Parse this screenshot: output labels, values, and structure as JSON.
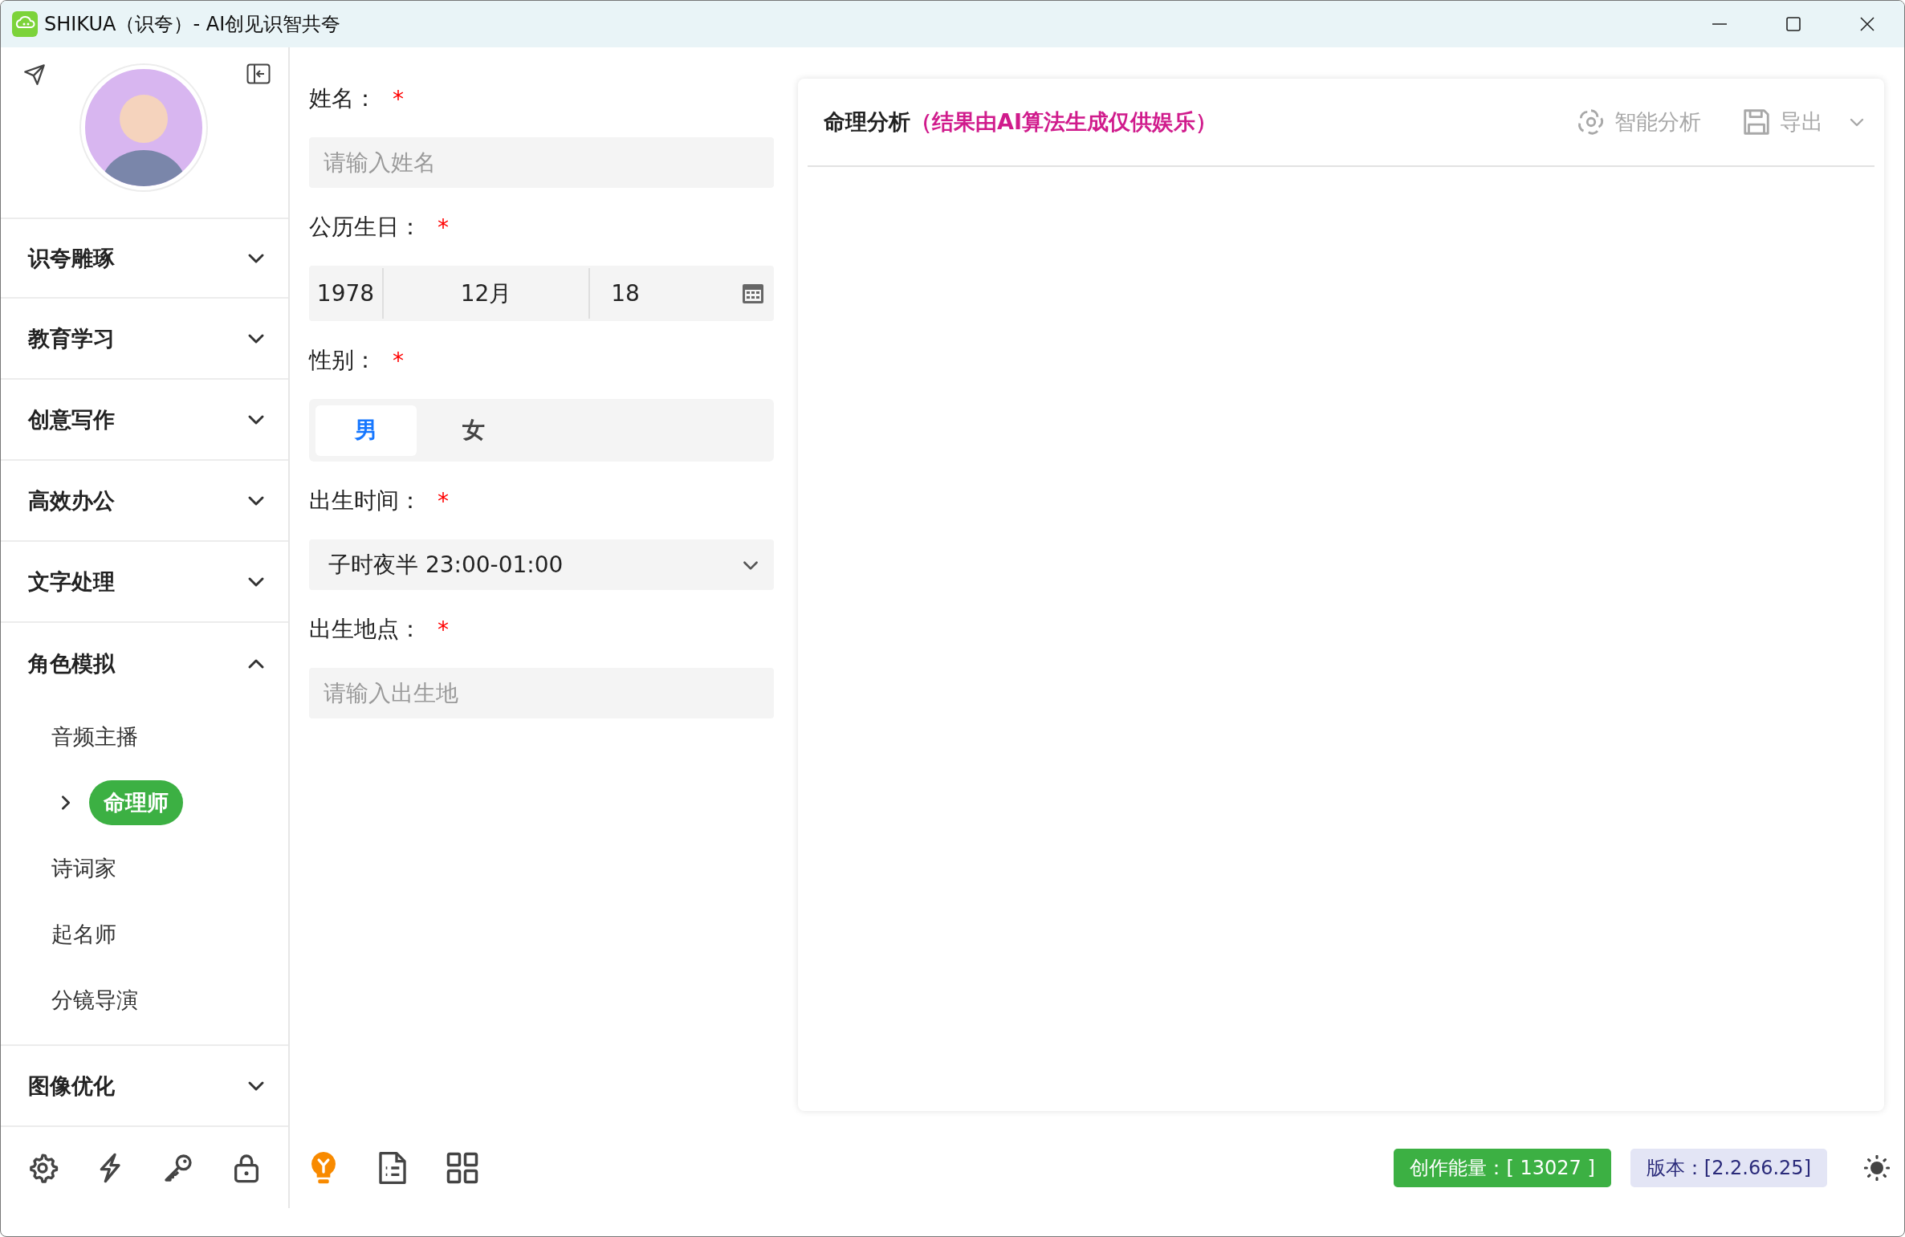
{
  "window": {
    "title": "SHIKUA（识夸）- AI创见识智共夸"
  },
  "sidebar": {
    "categories": [
      {
        "label": "识夸雕琢",
        "expanded": false
      },
      {
        "label": "教育学习",
        "expanded": false
      },
      {
        "label": "创意写作",
        "expanded": false
      },
      {
        "label": "高效办公",
        "expanded": false
      },
      {
        "label": "文字处理",
        "expanded": false
      },
      {
        "label": "角色模拟",
        "expanded": true,
        "children": [
          {
            "label": "音频主播",
            "selected": false
          },
          {
            "label": "命理师",
            "selected": true
          },
          {
            "label": "诗词家",
            "selected": false
          },
          {
            "label": "起名师",
            "selected": false
          },
          {
            "label": "分镜导演",
            "selected": false
          }
        ]
      },
      {
        "label": "图像优化",
        "expanded": false
      }
    ]
  },
  "form": {
    "fields": [
      {
        "kind": "text",
        "label": "姓名：",
        "mark": "*",
        "placeholder": "请输入姓名"
      },
      {
        "kind": "date",
        "label": "公历生日：",
        "mark": "*",
        "year": "1978",
        "month": "12月",
        "day": "18"
      },
      {
        "kind": "segmented",
        "label": "性别：",
        "mark": "*",
        "options": [
          {
            "label": "男",
            "selected": true
          },
          {
            "label": "女",
            "selected": false
          }
        ]
      },
      {
        "kind": "select",
        "label": "出生时间：",
        "mark": "*",
        "value": "子时夜半 23:00-01:00"
      },
      {
        "kind": "text",
        "label": "出生地点：",
        "mark": "*",
        "placeholder": "请输入出生地"
      }
    ]
  },
  "result": {
    "title": "命理分析",
    "note": "（结果由AI算法生成仅供娱乐）",
    "actions": [
      {
        "kind": "analyze",
        "label": "智能分析",
        "disabled": true
      },
      {
        "kind": "export",
        "label": "导出",
        "disabled": true
      }
    ]
  },
  "status_bar": {
    "energy": "创作能量：[ 13027 ]",
    "version": "版本：[2.2.66.25]"
  }
}
